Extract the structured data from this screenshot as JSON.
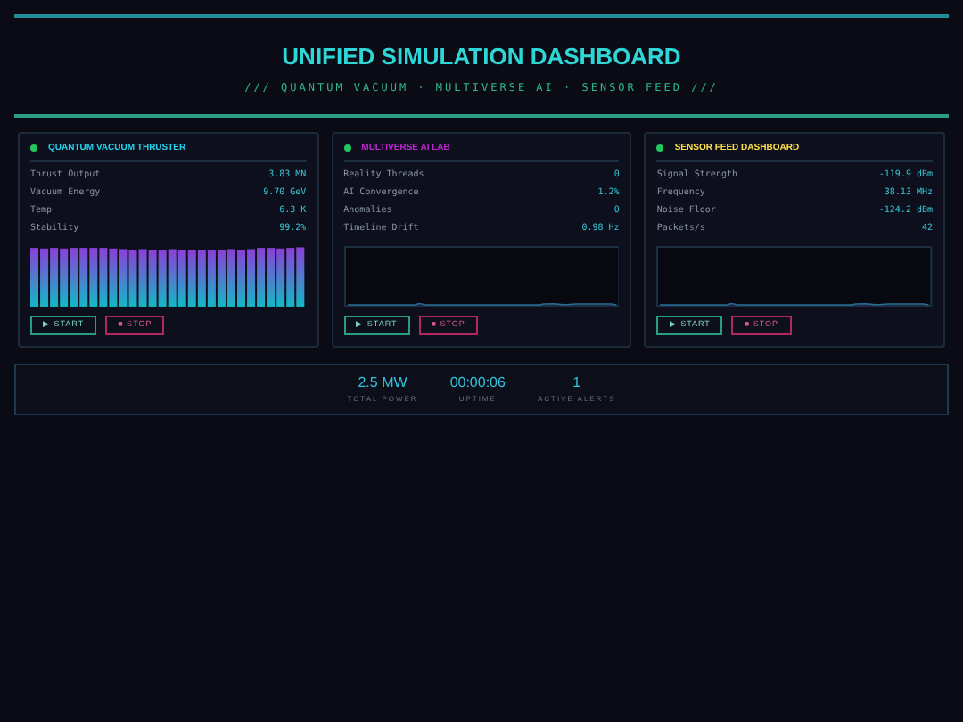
{
  "header": {
    "title": "UNIFIED SIMULATION DASHBOARD",
    "subtitle": "/// QUANTUM VACUUM · MULTIVERSE AI · SENSOR FEED ///"
  },
  "panels": [
    {
      "title": "QUANTUM VACUUM THRUSTER",
      "color": "#22d3ee",
      "kind": "bars",
      "metrics": [
        {
          "label": "Thrust Output",
          "value": "3.83 MN"
        },
        {
          "label": "Vacuum Energy",
          "value": "9.70 GeV"
        },
        {
          "label": "Temp",
          "value": "6.3 K"
        },
        {
          "label": "Stability",
          "value": "99.2%"
        }
      ],
      "buttons": [
        "▶ START",
        "■ STOP"
      ]
    },
    {
      "title": "MULTIVERSE AI LAB",
      "color": "#c026d3",
      "kind": "trace",
      "metrics": [
        {
          "label": "Reality Threads",
          "value": "0"
        },
        {
          "label": "AI Convergence",
          "value": "1.2%"
        },
        {
          "label": "Anomalies",
          "value": "0"
        },
        {
          "label": "Timeline Drift",
          "value": "0.98 Hz"
        }
      ],
      "buttons": [
        "▶ START",
        "■ STOP"
      ]
    },
    {
      "title": "SENSOR FEED DASHBOARD",
      "color": "#fde047",
      "kind": "trace",
      "metrics": [
        {
          "label": "Signal Strength",
          "value": "-119.9 dBm"
        },
        {
          "label": "Frequency",
          "value": "38.13 MHz"
        },
        {
          "label": "Noise Floor",
          "value": "-124.2 dBm"
        },
        {
          "label": "Packets/s",
          "value": "42"
        }
      ],
      "buttons": [
        "▶ START",
        "■ STOP"
      ]
    }
  ],
  "summary": [
    {
      "value": "2.5 MW",
      "label": "TOTAL POWER"
    },
    {
      "value": "00:00:06",
      "label": "UPTIME"
    },
    {
      "value": "1",
      "label": "ACTIVE ALERTS"
    }
  ]
}
